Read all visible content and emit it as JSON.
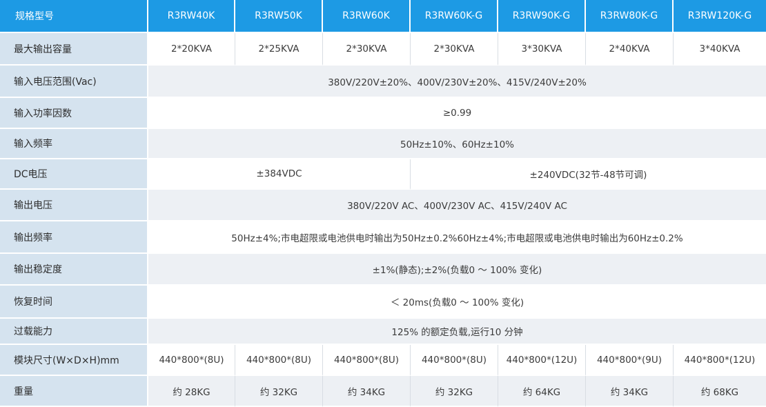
{
  "header": {
    "label": "规格型号",
    "models": [
      "R3RW40K",
      "R3RW50K",
      "R3RW60K",
      "R3RW60K-G",
      "R3RW90K-G",
      "R3RW80K-G",
      "R3RW120K-G"
    ]
  },
  "rows": {
    "max_output_capacity": {
      "label": "最大输出容量",
      "values": [
        "2*20KVA",
        "2*25KVA",
        "2*30KVA",
        "2*30KVA",
        "3*30KVA",
        "2*40KVA",
        "3*40KVA"
      ]
    },
    "input_voltage_range": {
      "label": "输入电压范围(Vac)",
      "value": "380V/220V±20%、400V/230V±20%、415V/240V±20%"
    },
    "input_power_factor": {
      "label": "输入功率因数",
      "value": "≥0.99"
    },
    "input_frequency": {
      "label": "输入频率",
      "value": "50Hz±10%、60Hz±10%"
    },
    "dc_voltage": {
      "label": "DC电压",
      "value_a": "±384VDC",
      "value_b": "±240VDC(32节-48节可调)"
    },
    "output_voltage": {
      "label": "输出电压",
      "value": "380V/220V AC、400V/230V AC、415V/240V AC"
    },
    "output_frequency": {
      "label": "输出频率",
      "value": "50Hz±4%;市电超限或电池供电时输出为50Hz±0.2%60Hz±4%;市电超限或电池供电时输出为60Hz±0.2%"
    },
    "output_stability": {
      "label": "输出稳定度",
      "value": "±1%(静态);±2%(负载0 ～ 100% 变化)"
    },
    "recovery_time": {
      "label": "恢复时间",
      "value": "＜ 20ms(负载0 ～ 100% 变化)"
    },
    "overload_capacity": {
      "label": "过载能力",
      "value": "125% 的额定负载,运行10 分钟"
    },
    "module_size": {
      "label": "模块尺寸(W×D×H)mm",
      "values": [
        "440*800*(8U)",
        "440*800*(8U)",
        "440*800*(8U)",
        "440*800*(8U)",
        "440*800*(12U)",
        "440*800*(9U)",
        "440*800*(12U)"
      ]
    },
    "weight": {
      "label": "重量",
      "values": [
        "约 28KG",
        "约 32KG",
        "约 34KG",
        "约 32KG",
        "约 64KG",
        "约 34KG",
        "约 68KG"
      ]
    }
  },
  "colors": {
    "header_blue": "#1d9ae4",
    "label_column": "#d5e3ef",
    "row_alt": "#edf0f4",
    "row_white": "#ffffff"
  }
}
